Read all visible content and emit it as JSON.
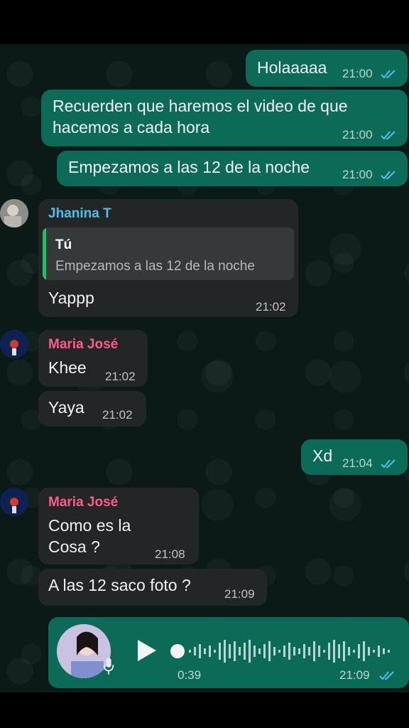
{
  "colors": {
    "outgoing_bubble": "#0c6b57",
    "incoming_bubble": "#232626",
    "read_ticks": "#53bdeb",
    "sender_jhanina": "#53bdeb",
    "sender_maria": "#ff5c8a"
  },
  "messages": {
    "m1": {
      "text": "Holaaaaa",
      "time": "21:00",
      "status_icon": "double-check-read-icon"
    },
    "m2": {
      "text": "Recuerden que haremos el video de que\nhacemos a cada hora",
      "time": "21:00",
      "status_icon": "double-check-read-icon"
    },
    "m3": {
      "text": "Empezamos a las 12 de la noche",
      "time": "21:00",
      "status_icon": "double-check-read-icon"
    },
    "m4": {
      "sender": "Jhanina T",
      "quote_author": "Tú",
      "quote_text": "Empezamos a las 12 de la noche",
      "text": "Yappp",
      "time": "21:02"
    },
    "m5": {
      "sender": "Maria José",
      "text": "Khee",
      "time": "21:02"
    },
    "m6": {
      "text": "Yaya",
      "time": "21:02"
    },
    "m7": {
      "text": "Xd",
      "time": "21:04",
      "status_icon": "double-check-read-icon"
    },
    "m8": {
      "sender": "Maria José",
      "text": "Como es la\nCosa ?",
      "time": "21:08"
    },
    "m9": {
      "text": "A las 12 saco foto ?",
      "time": "21:09"
    },
    "voice": {
      "duration": "0:39",
      "time": "21:09",
      "status_icon": "double-check-read-icon",
      "play_icon": "play-icon",
      "mic_icon": "microphone-icon"
    }
  }
}
